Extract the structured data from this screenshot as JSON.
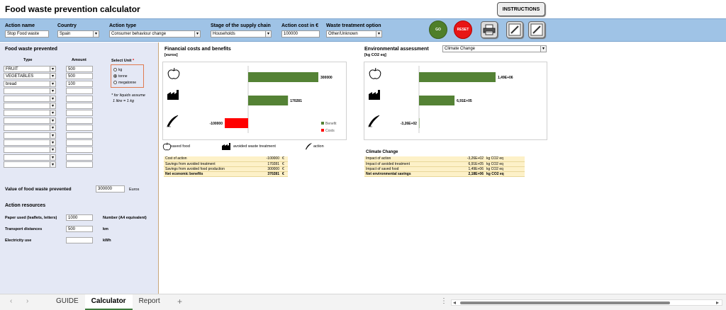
{
  "app": {
    "title": "Food waste prevention calculator",
    "instructions_label": "INSTRUCTIONS"
  },
  "topbar": {
    "action_name_label": "Action name",
    "action_name_value": "Stop Food waste",
    "country_label": "Country",
    "country_value": "Spain",
    "action_type_label": "Action type",
    "action_type_value": "Consumer behaviour change",
    "stage_label": "Stage of the supply chain",
    "stage_value": "Households",
    "cost_label": "Action cost in €",
    "cost_value": "100000",
    "treatment_label": "Waste treatment option",
    "treatment_value": "Other/Unknown",
    "go_label": "GO",
    "reset_label": "RESET"
  },
  "left": {
    "section_title": "Food waste prevented",
    "type_header": "Type",
    "amount_header": "Amount",
    "rows": [
      {
        "type": "FRUIT",
        "amount": "500"
      },
      {
        "type": "VEGETABLES",
        "amount": "500"
      },
      {
        "type": "bread",
        "amount": "100"
      },
      {
        "type": "",
        "amount": ""
      },
      {
        "type": "",
        "amount": ""
      },
      {
        "type": "",
        "amount": ""
      },
      {
        "type": "",
        "amount": ""
      },
      {
        "type": "",
        "amount": ""
      },
      {
        "type": "",
        "amount": ""
      },
      {
        "type": "",
        "amount": ""
      },
      {
        "type": "",
        "amount": ""
      },
      {
        "type": "",
        "amount": ""
      },
      {
        "type": "",
        "amount": ""
      },
      {
        "type": "",
        "amount": ""
      }
    ],
    "unit_label": "Select Unit",
    "unit_options": [
      "kg",
      "tonne",
      "megatonne"
    ],
    "unit_selected": 1,
    "note_line1": "* for liquids assume",
    "note_line2": "1 litre = 1 kg",
    "value_label": "Value of food waste prevented",
    "value_amount": "300000",
    "value_unit": "Euros",
    "resources_title": "Action resources",
    "paper_label": "Paper used (leaflets, letters)",
    "paper_value": "1000",
    "paper_unit": "Number (A4 equivalent)",
    "transport_label": "Transport distances",
    "transport_value": "500",
    "transport_unit": "km",
    "electricity_label": "Electricity use",
    "electricity_value": "",
    "electricity_unit": "kWh"
  },
  "financial": {
    "title": "Financial costs and benefits",
    "subtitle": "[euros]",
    "legend_benefit": "Benefit",
    "legend_costs": "Costs",
    "icon_legend": [
      "saved food",
      "avoided waste treatment",
      "action"
    ],
    "table": [
      {
        "label": "Cost of action",
        "value": "-100000",
        "unit": "€",
        "bold": false
      },
      {
        "label": "Savings from avoided treatment",
        "value": "170281",
        "unit": "€",
        "bold": false
      },
      {
        "label": "Savings from avoided food production",
        "value": "300000",
        "unit": "€",
        "bold": false
      },
      {
        "label": "Net economic benefits",
        "value": "370281",
        "unit": "€",
        "bold": true
      }
    ]
  },
  "environmental": {
    "title": "Environmental assessment",
    "subtitle": "[kg CO2 eq]",
    "category_value": "Climate Change",
    "table_title": "Climate Change",
    "table": [
      {
        "label": "Impact of action",
        "value": "-3,26E+02",
        "unit": "kg CO2 eq",
        "bold": false
      },
      {
        "label": "Impact of avoided treatment",
        "value": "6,91E+05",
        "unit": "kg CO2 eq",
        "bold": false
      },
      {
        "label": "Impact of saved food",
        "value": "1,49E+06",
        "unit": "kg CO2 eq",
        "bold": false
      },
      {
        "label": "Net environmental savings",
        "value": "2,18E+06",
        "unit": "kg CO2 eq",
        "bold": true
      }
    ]
  },
  "chart_data": [
    {
      "type": "bar",
      "categories": [
        "saved food",
        "avoided waste treatment",
        "action"
      ],
      "series": [
        {
          "name": "Benefit",
          "values": [
            300000,
            170281,
            0
          ]
        },
        {
          "name": "Costs",
          "values": [
            0,
            0,
            -100000
          ]
        }
      ],
      "data_labels": [
        "300000",
        "170281",
        "-100000"
      ],
      "colors": {
        "Benefit": "#548235",
        "Costs": "#ff0000"
      },
      "orientation": "horizontal",
      "legend": "bottom-right"
    },
    {
      "type": "bar",
      "categories": [
        "saved food",
        "avoided waste treatment",
        "action"
      ],
      "values": [
        1490000,
        691000,
        -326
      ],
      "data_labels": [
        "1,49E+06",
        "6,91E+05",
        "-3,26E+02"
      ],
      "colors": {
        "bar": "#548235"
      },
      "orientation": "horizontal"
    }
  ],
  "tabs": {
    "items": [
      "GUIDE",
      "Calculator",
      "Report"
    ],
    "active": 1,
    "add_label": "+"
  },
  "colors": {
    "topbar": "#9fc3e6",
    "panel": "#e4e8f5",
    "go": "#4f7f2a",
    "reset": "#e81515",
    "table_fill": "#fdf1c8"
  }
}
